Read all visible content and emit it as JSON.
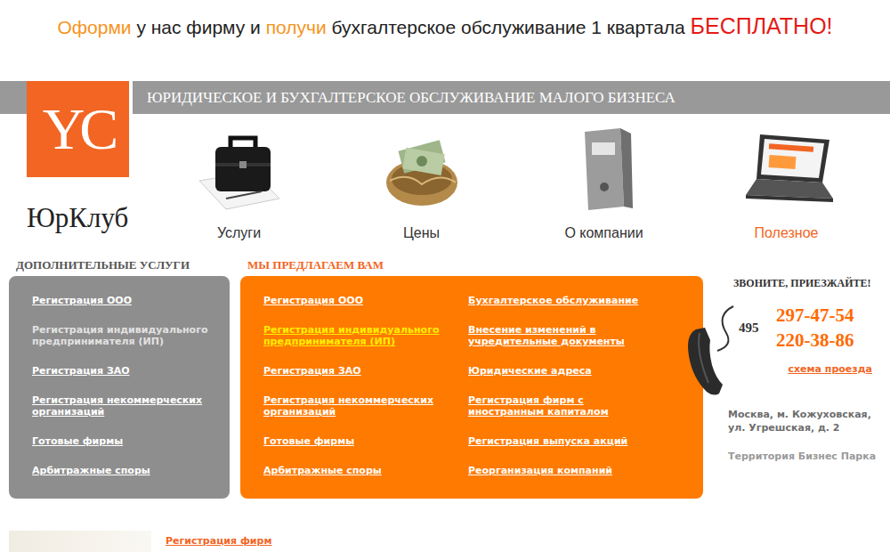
{
  "promo": [
    {
      "text": "Оформи",
      "kind": "accent"
    },
    {
      "text": " у нас фирму и ",
      "kind": "plain"
    },
    {
      "text": "получи",
      "kind": "accent"
    },
    {
      "text": " бухгалтерское обслуживание 1 квартала ",
      "kind": "plain"
    },
    {
      "text": "БЕСПЛАТНО!",
      "kind": "alert"
    }
  ],
  "logo": {
    "mark": "YC",
    "name": "ЮрКлуб"
  },
  "tagline": "ЮРИДИЧЕСКОЕ И БУХГАЛТЕРСКОЕ ОБСЛУЖИВАНИЕ МАЛОГО БИЗНЕСА",
  "nav": [
    {
      "label": "Услуги",
      "selected": false
    },
    {
      "label": "Цены",
      "selected": false
    },
    {
      "label": "О компании",
      "selected": false
    },
    {
      "label": "Полезное",
      "selected": true
    }
  ],
  "extra_services": {
    "title": "ДОПОЛНИТЕЛЬНЫЕ УСЛУГИ",
    "items": [
      {
        "label": "Регистрация ООО",
        "selected": false
      },
      {
        "label": "Регистрация индивидуального предпринимателя (ИП)",
        "selected": true
      },
      {
        "label": "Регистрация ЗАО",
        "selected": false
      },
      {
        "label": "Регистрация некоммерческих организаций",
        "selected": false
      },
      {
        "label": "Готовые фирмы",
        "selected": false
      },
      {
        "label": "Арбитражные споры",
        "selected": false
      }
    ]
  },
  "offers": {
    "title": "МЫ ПРЕДЛАГАЕМ ВАМ",
    "columns": [
      [
        {
          "label": "Регистрация ООО",
          "selected": false
        },
        {
          "label": "Регистрация индивидуального предпринимателя (ИП)",
          "selected": true
        },
        {
          "label": "Регистрация ЗАО",
          "selected": false
        },
        {
          "label": "Регистрация некоммерческих организаций",
          "selected": false
        },
        {
          "label": "Готовые фирмы",
          "selected": false
        },
        {
          "label": "Арбитражные споры",
          "selected": false
        }
      ],
      [
        {
          "label": "Бухгалтерское обслуживание",
          "selected": false
        },
        {
          "label": "Внесение изменений в учредительные документы",
          "selected": false
        },
        {
          "label": "Юридические адреса",
          "selected": false
        },
        {
          "label": "Регистрация фирм с иностранным капиталом",
          "selected": false
        },
        {
          "label": "Регистрация выпуска акций",
          "selected": false
        },
        {
          "label": "Реорганизация компаний",
          "selected": false
        }
      ]
    ]
  },
  "contact": {
    "title": "ЗВОНИТЕ, ПРИЕЗЖАЙТЕ!",
    "code": "495",
    "phones": [
      "297-47-54",
      "220-38-86"
    ],
    "map_link": "схема проезда",
    "address": [
      "Москва, м. Кожуховская,",
      "ул. Угрешская, д. 2"
    ],
    "place": "Территория Бизнес Парка"
  },
  "footer_link": "Регистрация фирм"
}
